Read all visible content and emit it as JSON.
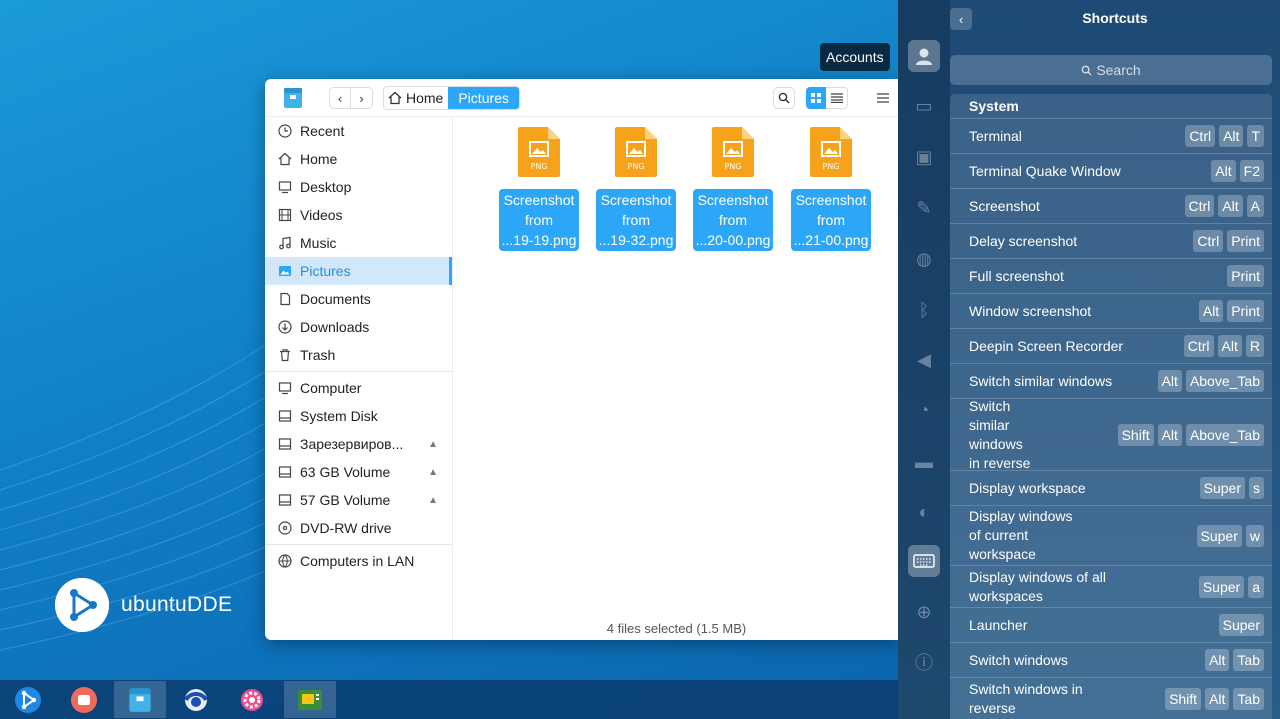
{
  "desktop": {
    "brand": "ubuntuDDE"
  },
  "file_manager": {
    "breadcrumb": {
      "home": "Home",
      "current": "Pictures"
    },
    "sidebar": [
      {
        "label": "Recent",
        "icon": "clock-icon"
      },
      {
        "label": "Home",
        "icon": "home-icon"
      },
      {
        "label": "Desktop",
        "icon": "desktop-icon"
      },
      {
        "label": "Videos",
        "icon": "video-icon"
      },
      {
        "label": "Music",
        "icon": "music-icon"
      },
      {
        "label": "Pictures",
        "icon": "picture-icon",
        "active": true
      },
      {
        "label": "Documents",
        "icon": "document-icon"
      },
      {
        "label": "Downloads",
        "icon": "download-icon"
      },
      {
        "label": "Trash",
        "icon": "trash-icon"
      },
      {
        "label": "Computer",
        "icon": "computer-icon"
      },
      {
        "label": "System Disk",
        "icon": "disk-icon"
      },
      {
        "label": "Зарезервиров...",
        "icon": "disk-icon"
      },
      {
        "label": "63 GB Volume",
        "icon": "disk-icon"
      },
      {
        "label": "57 GB Volume",
        "icon": "disk-icon"
      },
      {
        "label": "DVD-RW drive",
        "icon": "dvd-icon"
      },
      {
        "label": "Computers in LAN",
        "icon": "network-icon"
      }
    ],
    "files": [
      {
        "line1": "Screenshot",
        "line2": "from",
        "line3": "...19-19.png",
        "type": "PNG"
      },
      {
        "line1": "Screenshot",
        "line2": "from",
        "line3": "...19-32.png",
        "type": "PNG"
      },
      {
        "line1": "Screenshot",
        "line2": "from",
        "line3": "...20-00.png",
        "type": "PNG"
      },
      {
        "line1": "Screenshot",
        "line2": "from",
        "line3": "...21-00.png",
        "type": "PNG"
      }
    ],
    "status": "4 files selected (1.5 MB)"
  },
  "control_center": {
    "title": "Shortcuts",
    "tooltip": "Accounts",
    "search_placeholder": "Search",
    "section": "System",
    "shortcuts": [
      {
        "name": "Terminal",
        "keys": [
          "Ctrl",
          "Alt",
          "T"
        ]
      },
      {
        "name": "Terminal Quake Window",
        "keys": [
          "Alt",
          "F2"
        ]
      },
      {
        "name": "Screenshot",
        "keys": [
          "Ctrl",
          "Alt",
          "A"
        ]
      },
      {
        "name": "Delay screenshot",
        "keys": [
          "Ctrl",
          "Print"
        ]
      },
      {
        "name": "Full screenshot",
        "keys": [
          "Print"
        ]
      },
      {
        "name": "Window screenshot",
        "keys": [
          "Alt",
          "Print"
        ]
      },
      {
        "name": "Deepin Screen Recorder",
        "keys": [
          "Ctrl",
          "Alt",
          "R"
        ]
      },
      {
        "name": "Switch similar windows",
        "keys": [
          "Alt",
          "Above_Tab"
        ]
      },
      {
        "name": "Switch\nsimilar\nwindows\nin reverse",
        "keys": [
          "Shift",
          "Alt",
          "Above_Tab"
        ]
      },
      {
        "name": "Display workspace",
        "keys": [
          "Super",
          "s"
        ]
      },
      {
        "name": "Display windows\nof current\nworkspace",
        "keys": [
          "Super",
          "w"
        ]
      },
      {
        "name": "Display windows of all\nworkspaces",
        "keys": [
          "Super",
          "a"
        ]
      },
      {
        "name": "Launcher",
        "keys": [
          "Super"
        ]
      },
      {
        "name": "Switch windows",
        "keys": [
          "Alt",
          "Tab"
        ]
      },
      {
        "name": "Switch windows in\nreverse",
        "keys": [
          "Shift",
          "Alt",
          "Tab"
        ]
      }
    ]
  },
  "colors": {
    "accent": "#2ca7f8",
    "png_orange": "#f7a21b"
  }
}
